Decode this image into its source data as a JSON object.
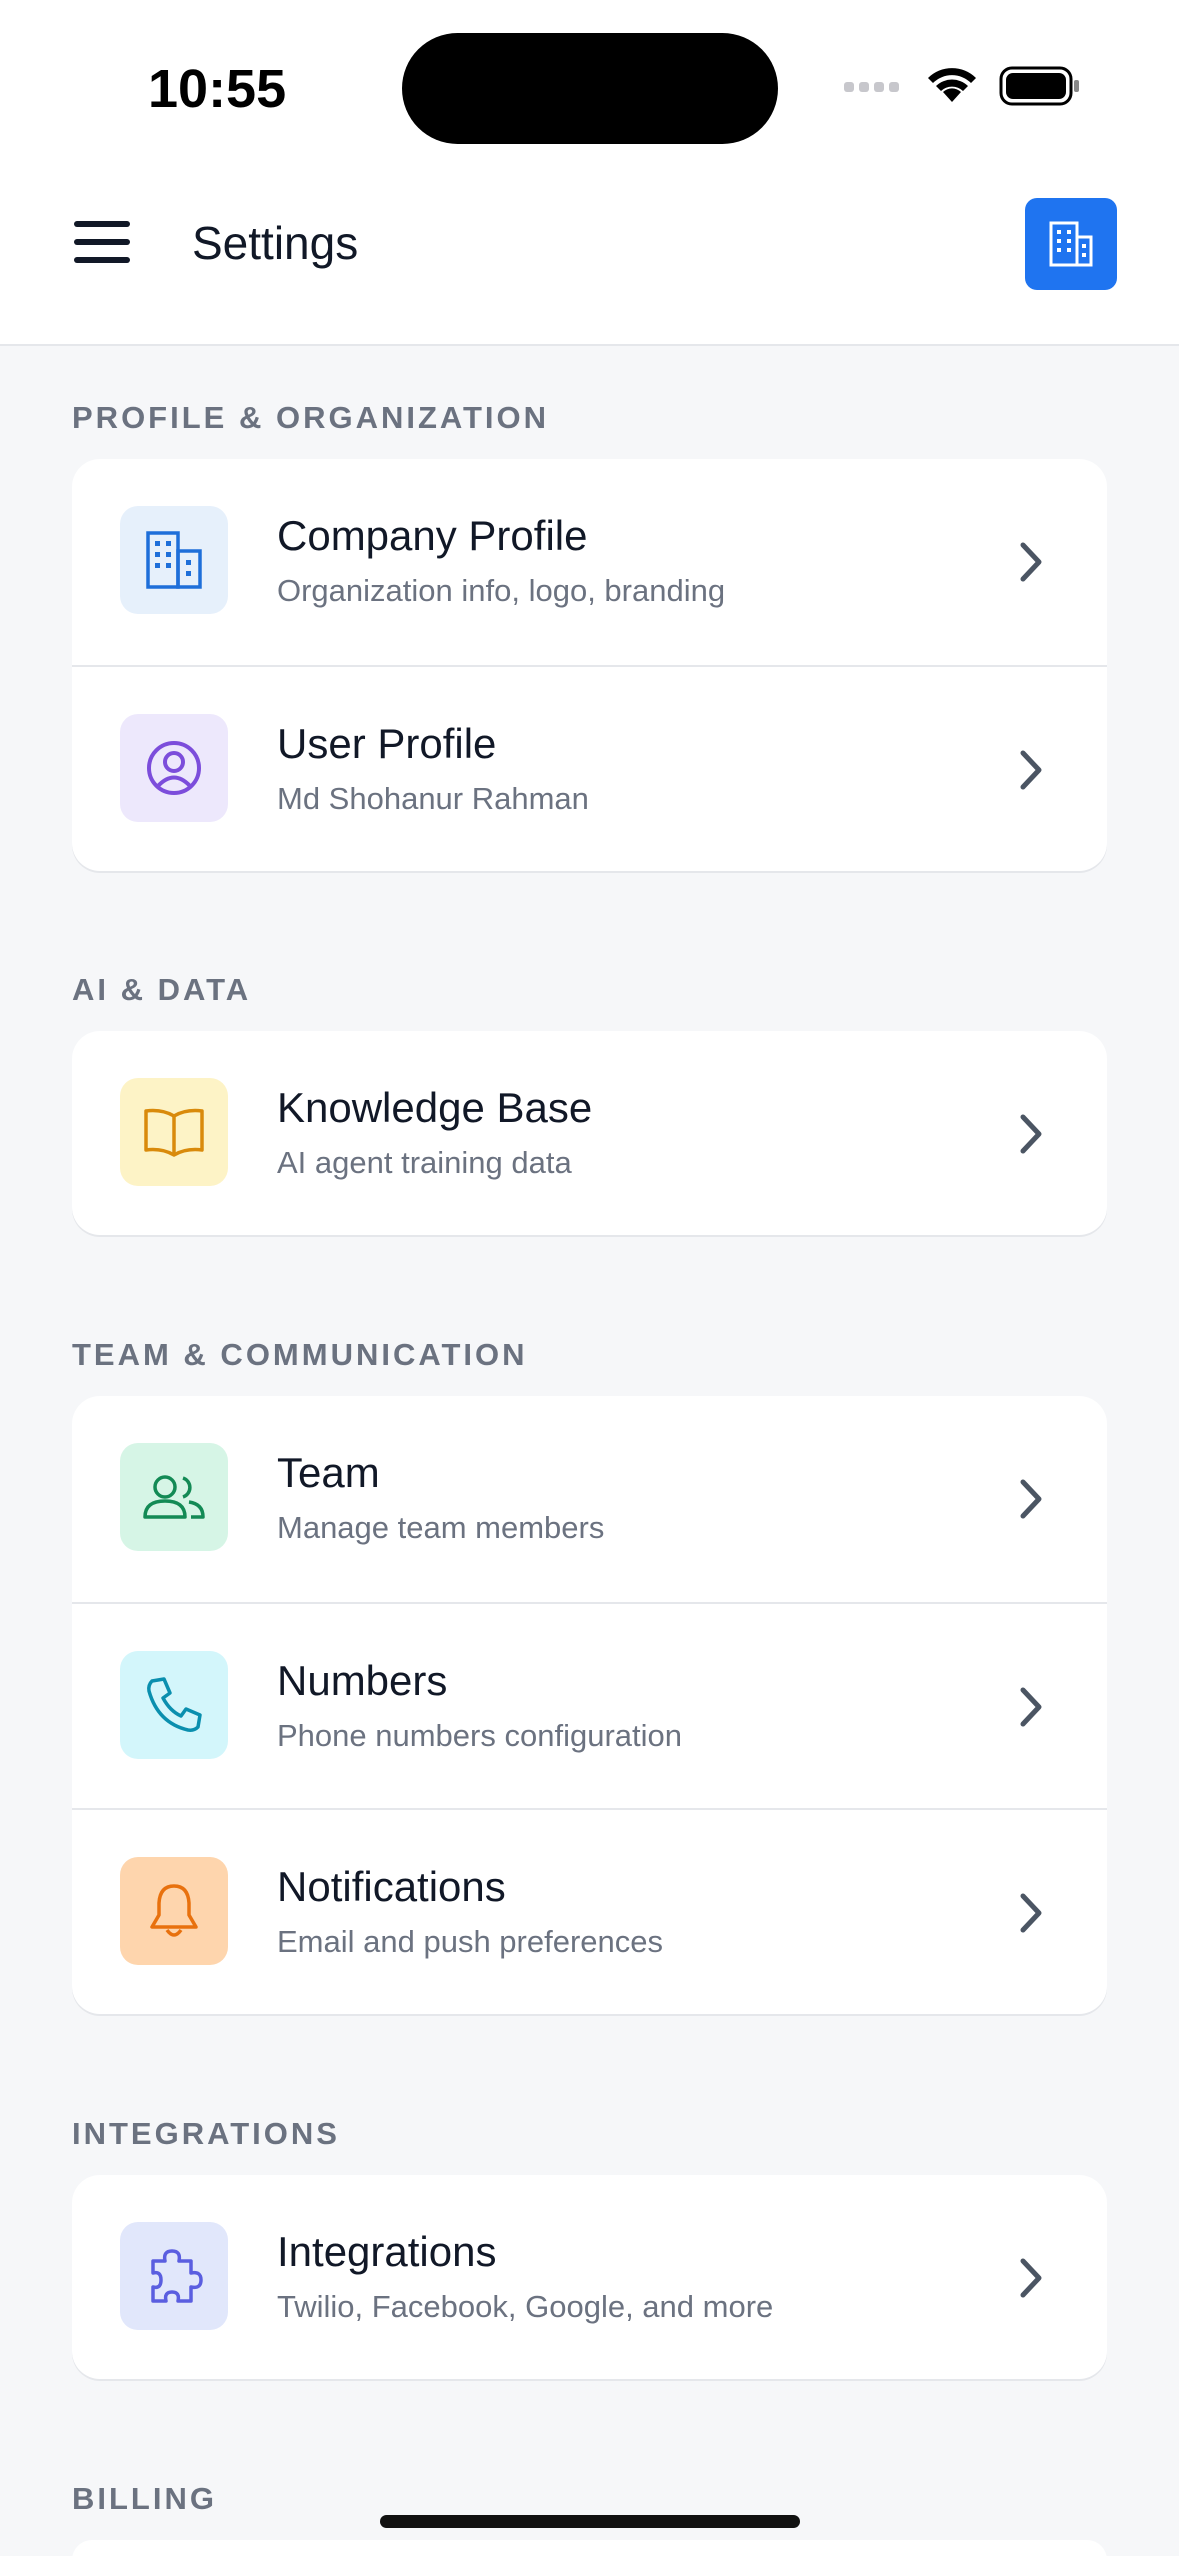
{
  "status_bar": {
    "time": "10:55"
  },
  "header": {
    "title": "Settings"
  },
  "sections": [
    {
      "label": "PROFILE & ORGANIZATION",
      "items": [
        {
          "title": "Company Profile",
          "subtitle": "Organization info, logo, branding",
          "icon": "building-icon"
        },
        {
          "title": "User Profile",
          "subtitle": "Md Shohanur Rahman",
          "icon": "user-circle-icon"
        }
      ]
    },
    {
      "label": "AI & DATA",
      "items": [
        {
          "title": "Knowledge Base",
          "subtitle": "AI agent training data",
          "icon": "book-icon"
        }
      ]
    },
    {
      "label": "TEAM & COMMUNICATION",
      "items": [
        {
          "title": "Team",
          "subtitle": "Manage team members",
          "icon": "users-icon"
        },
        {
          "title": "Numbers",
          "subtitle": "Phone numbers configuration",
          "icon": "phone-icon"
        },
        {
          "title": "Notifications",
          "subtitle": "Email and push preferences",
          "icon": "bell-icon"
        }
      ]
    },
    {
      "label": "INTEGRATIONS",
      "items": [
        {
          "title": "Integrations",
          "subtitle": "Twilio, Facebook, Google, and more",
          "icon": "puzzle-icon"
        }
      ]
    },
    {
      "label": "BILLING",
      "items": []
    }
  ],
  "colors": {
    "accent": "#1f74f0",
    "background": "#f6f7f9",
    "icon_bg_blue": "#e6f0fb",
    "icon_bg_purple": "#ede8fc",
    "icon_bg_yellow": "#fdf3c6",
    "icon_bg_green": "#d6f5e6",
    "icon_bg_cyan": "#d3f6fb",
    "icon_bg_orange": "#fed5ad",
    "icon_bg_indigo": "#e1e7fb"
  }
}
